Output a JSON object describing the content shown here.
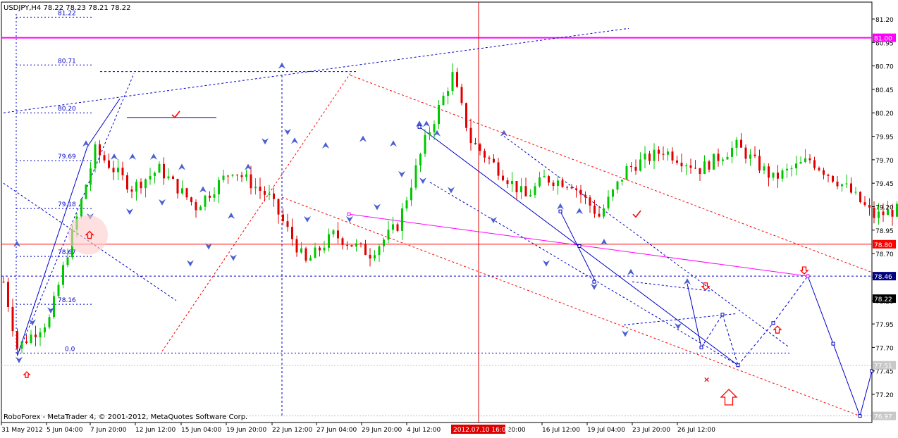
{
  "chart_data": {
    "type": "candlestick",
    "header": "USDJPY,H4  78.22 78.23 78.21 78.22",
    "footer": "RoboForex - MetaTrader 4, © 2001-2012, MetaQuotes Software Corp.",
    "ylim": [
      76.9,
      81.38
    ],
    "y_ticks": [
      "81.20",
      "80.95",
      "80.70",
      "80.45",
      "80.20",
      "79.95",
      "79.70",
      "79.45",
      "79.20",
      "78.95",
      "78.70",
      "78.45",
      "78.20",
      "77.95",
      "77.70",
      "77.45",
      "77.20"
    ],
    "x_ticks": [
      "31 May 2012",
      "5 Jun 04:00",
      "7 Jun 20:00",
      "12 Jun 12:00",
      "15 Jun 04:00",
      "19 Jun 20:00",
      "22 Jun 12:00",
      "27 Jun 04:00",
      "29 Jun 20:00",
      "4 Jul 12:00",
      "Jul 20:00",
      "16 Jul 12:00",
      "19 Jul 04:00",
      "23 Jul 20:00",
      "26 Jul 12:00"
    ],
    "crosshair_time": "2012.07.10 16:00",
    "price_labels": [
      {
        "value": 81.0,
        "text": "81.00",
        "color": "#ff00ff"
      },
      {
        "value": 78.8,
        "text": "78.80",
        "color": "#ff0000"
      },
      {
        "value": 78.46,
        "text": "78.46",
        "color": "#000080"
      },
      {
        "value": 78.22,
        "text": "78.22",
        "color": "#000000"
      },
      {
        "value": 77.51,
        "text": "77.51",
        "color": "#c8c8c8"
      },
      {
        "value": 76.97,
        "text": "76.97",
        "color": "#c8c8c8"
      }
    ],
    "fib_levels": [
      {
        "label": "81.22",
        "value": 81.22
      },
      {
        "label": "80.71",
        "value": 80.71
      },
      {
        "label": "80.20",
        "value": 80.2
      },
      {
        "label": "79.69",
        "value": 79.69
      },
      {
        "label": "79.18",
        "value": 79.18
      },
      {
        "label": "78.67",
        "value": 78.67
      },
      {
        "label": "78.16",
        "value": 78.16
      },
      {
        "label": "0.0",
        "value": 77.64
      }
    ],
    "key_points": [
      {
        "time": "31 May 2012",
        "price": 77.62
      },
      {
        "time": "7 Jun 20:00",
        "price": 79.8
      },
      {
        "time": "15 Jun 04:00",
        "price": 78.6
      },
      {
        "time": "22 Jun 12:00",
        "price": 80.6
      },
      {
        "time": "27 Jun 04:00",
        "price": 79.1
      },
      {
        "time": "4 Jul 12:00",
        "price": 80.05
      },
      {
        "time": "2012.07.10 16:00",
        "price": 79.2
      },
      {
        "time": "16 Jul 12:00",
        "price": 78.75
      },
      {
        "time": "19 Jul 04:00",
        "price": 78.4
      },
      {
        "time": "23 Jul 20:00",
        "price": 77.9
      },
      {
        "time": "26 Jul 12:00",
        "price": 78.22
      }
    ],
    "forecast": [
      {
        "label": "low",
        "price": 77.51
      },
      {
        "label": "high",
        "price": 78.46
      },
      {
        "label": "target",
        "price": 76.97
      }
    ]
  },
  "colors": {
    "bull": "#00c800",
    "bear": "#e00000",
    "trend_blue": "#0000c8",
    "channel_red": "#ff0000",
    "magenta": "#ff00ff",
    "arrow_red": "#ff0000",
    "fractal": "#4a5fd0"
  }
}
